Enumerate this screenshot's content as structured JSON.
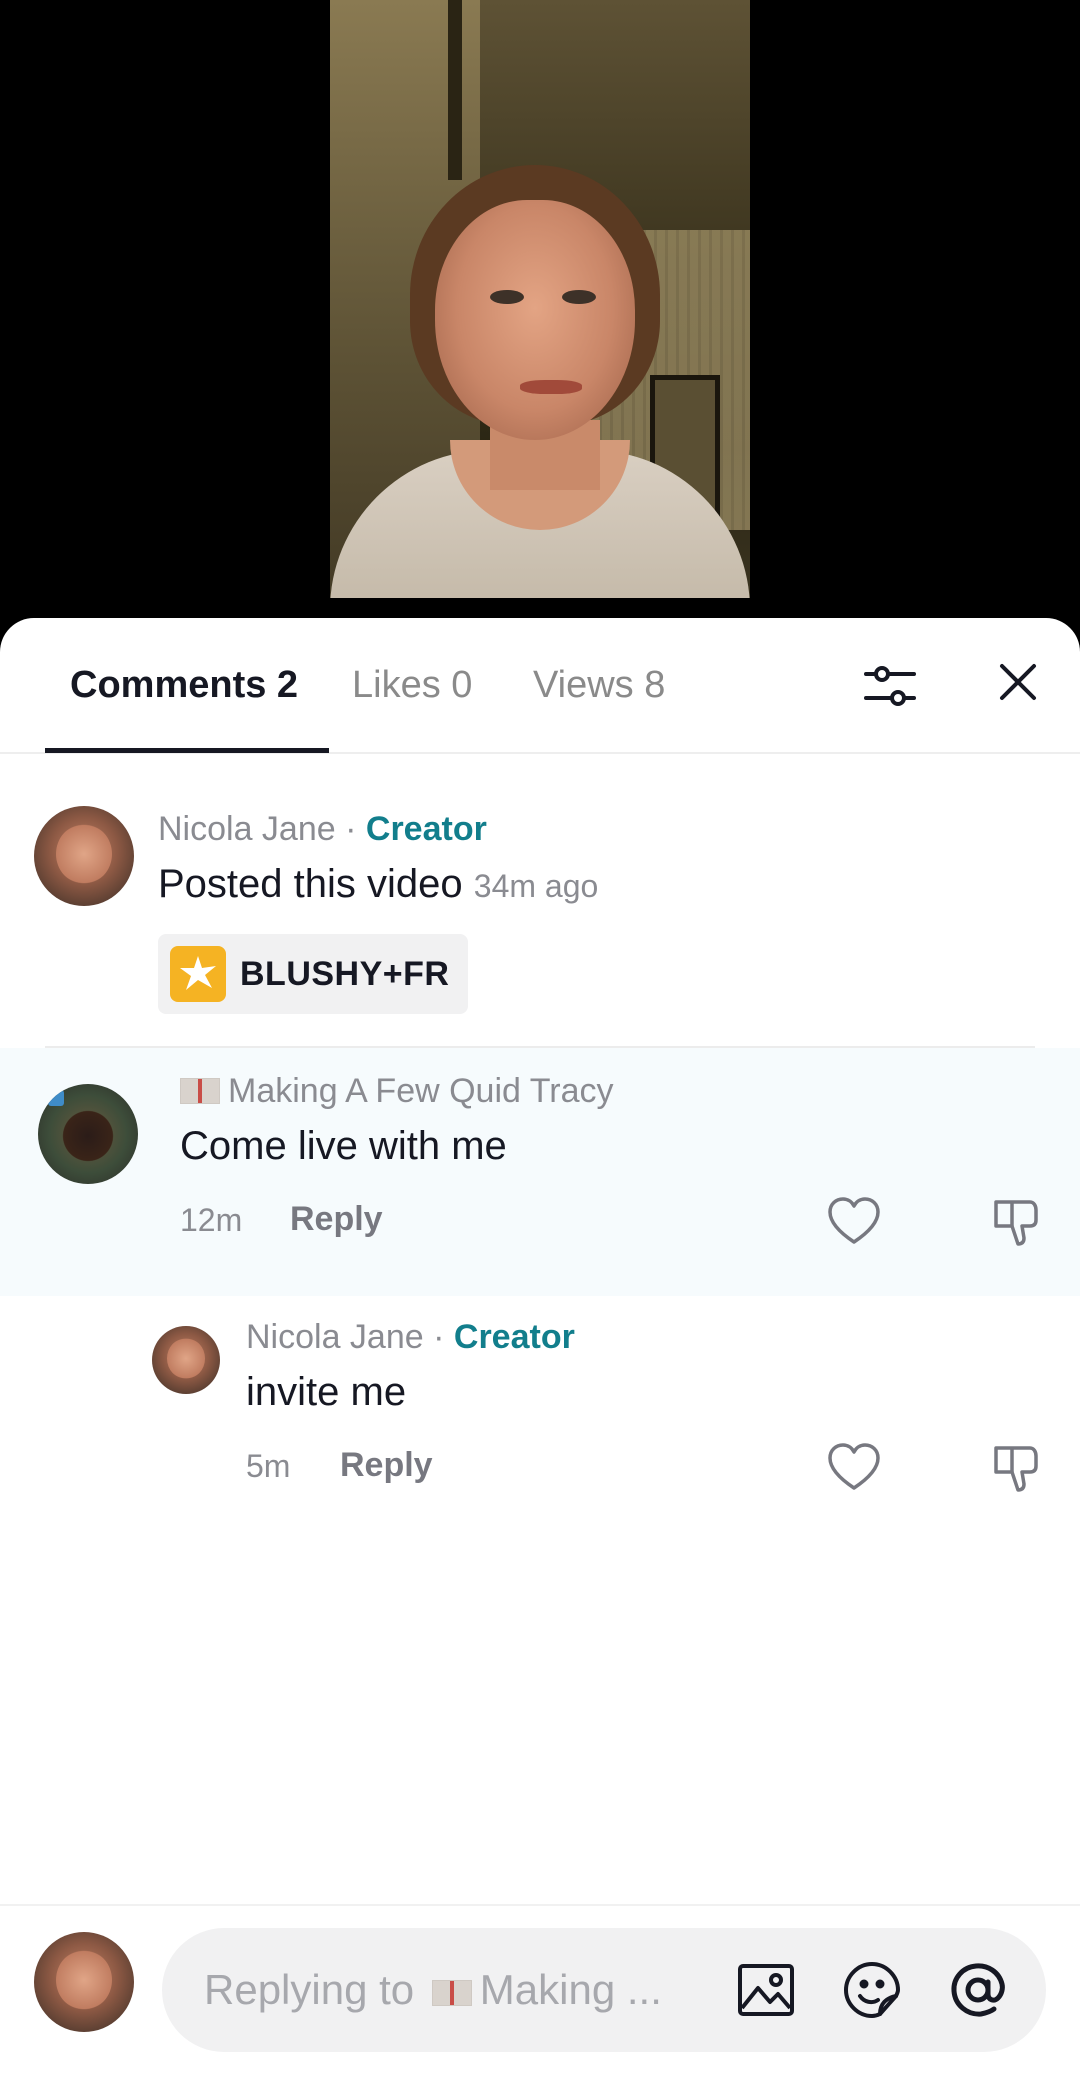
{
  "video": {
    "description_icon": "video-frame"
  },
  "tabs": [
    {
      "label": "Comments 2",
      "active": true
    },
    {
      "label": "Likes 0",
      "active": false
    },
    {
      "label": "Views 8",
      "active": false
    }
  ],
  "header_icons": {
    "filter": "filter-sliders-icon",
    "close": "close-icon"
  },
  "creator_post": {
    "username": "Nicola Jane",
    "separator": "·",
    "creator_label": "Creator",
    "text": "Posted this video",
    "time": "34m ago",
    "effect": {
      "label": "BLUSHY+FR",
      "icon": "sparkle-icon"
    }
  },
  "comments": [
    {
      "username": "Making A Few Quid Tracy",
      "text": "Come live with me",
      "time": "12m",
      "reply_label": "Reply"
    }
  ],
  "replies": [
    {
      "username": "Nicola Jane",
      "separator": "·",
      "creator_label": "Creator",
      "text": "invite me",
      "time": "5m",
      "reply_label": "Reply"
    }
  ],
  "composer": {
    "placeholder_prefix": "Replying to",
    "placeholder_suffix": "Making ...",
    "icons": [
      "image-icon",
      "sticker-icon",
      "mention-icon"
    ]
  },
  "colors": {
    "creator": "#127e8c",
    "effect_bg": "#f5b323",
    "highlight": "#f6fbfd"
  }
}
